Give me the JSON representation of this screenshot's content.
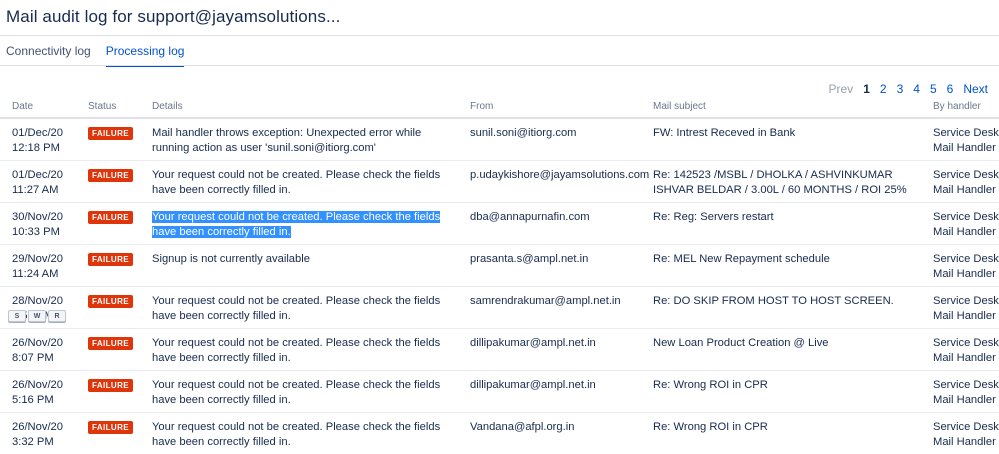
{
  "title": "Mail audit log for support@jayamsolutions...",
  "tabs": [
    {
      "label": "Connectivity log",
      "active": false
    },
    {
      "label": "Processing log",
      "active": true
    }
  ],
  "pagination": {
    "prev": "Prev",
    "pages": [
      "1",
      "2",
      "3",
      "4",
      "5",
      "6"
    ],
    "current": "1",
    "next": "Next"
  },
  "columns": {
    "date": "Date",
    "status": "Status",
    "details": "Details",
    "from": "From",
    "subject": "Mail subject",
    "handler": "By handler"
  },
  "rows": [
    {
      "date1": "01/Dec/20",
      "date2": "12:18 PM",
      "status": "FAILURE",
      "details": "Mail handler throws exception: Unexpected error while running action as user 'sunil.soni@itiorg.com'",
      "from": "sunil.soni@itiorg.com",
      "subject": "FW: Intrest Receved in Bank",
      "handler1": "Service Desk",
      "handler2": "Mail Handler"
    },
    {
      "date1": "01/Dec/20",
      "date2": "11:27 AM",
      "status": "FAILURE",
      "details": "Your request could not be created. Please check the fields have been correctly filled in.",
      "from": "p.udaykishore@jayamsolutions.com",
      "subject": "Re: 142523 /MSBL / DHOLKA / ASHVINKUMAR ISHVAR BELDAR / 3.00L / 60 MONTHS / ROI 25%",
      "handler1": "Service Desk",
      "handler2": "Mail Handler"
    },
    {
      "date1": "30/Nov/20",
      "date2": "10:33 PM",
      "status": "FAILURE",
      "details": "Your request could not be created. Please check the fields have been correctly filled in.",
      "from": "dba@annapurnafin.com",
      "subject": "Re: Reg: Servers restart",
      "handler1": "Service Desk",
      "handler2": "Mail Handler"
    },
    {
      "date1": "29/Nov/20",
      "date2": "11:24 AM",
      "status": "FAILURE",
      "details": "Signup is not currently available",
      "from": "prasanta.s@ampl.net.in",
      "subject": "Re: MEL New Repayment schedule",
      "handler1": "Service Desk",
      "handler2": "Mail Handler"
    },
    {
      "date1": "28/Nov/20",
      "date2": "8:52 PM",
      "status": "FAILURE",
      "details": "Your request could not be created. Please check the fields have been correctly filled in.",
      "from": "samrendrakumar@ampl.net.in",
      "subject": "Re: DO SKIP FROM HOST TO HOST SCREEN.",
      "handler1": "Service Desk",
      "handler2": "Mail Handler"
    },
    {
      "date1": "26/Nov/20",
      "date2": "8:07 PM",
      "status": "FAILURE",
      "details": "Your request could not be created. Please check the fields have been correctly filled in.",
      "from": "dillipakumar@ampl.net.in",
      "subject": "New Loan Product Creation @ Live",
      "handler1": "Service Desk",
      "handler2": "Mail Handler"
    },
    {
      "date1": "26/Nov/20",
      "date2": "5:16 PM",
      "status": "FAILURE",
      "details": "Your request could not be created. Please check the fields have been correctly filled in.",
      "from": "dillipakumar@ampl.net.in",
      "subject": "Re: Wrong ROI in CPR",
      "handler1": "Service Desk",
      "handler2": "Mail Handler"
    },
    {
      "date1": "26/Nov/20",
      "date2": "3:32 PM",
      "status": "FAILURE",
      "details": "Your request could not be created. Please check the fields have been correctly filled in.",
      "from": "Vandana@afpl.org.in",
      "subject": "Re: Wrong ROI in CPR",
      "handler1": "Service Desk",
      "handler2": "Mail Handler"
    }
  ],
  "keys": [
    "S",
    "W",
    "R"
  ],
  "colors": {
    "accent": "#0052cc",
    "failure": "#de350b",
    "selection": "#3390ff"
  }
}
